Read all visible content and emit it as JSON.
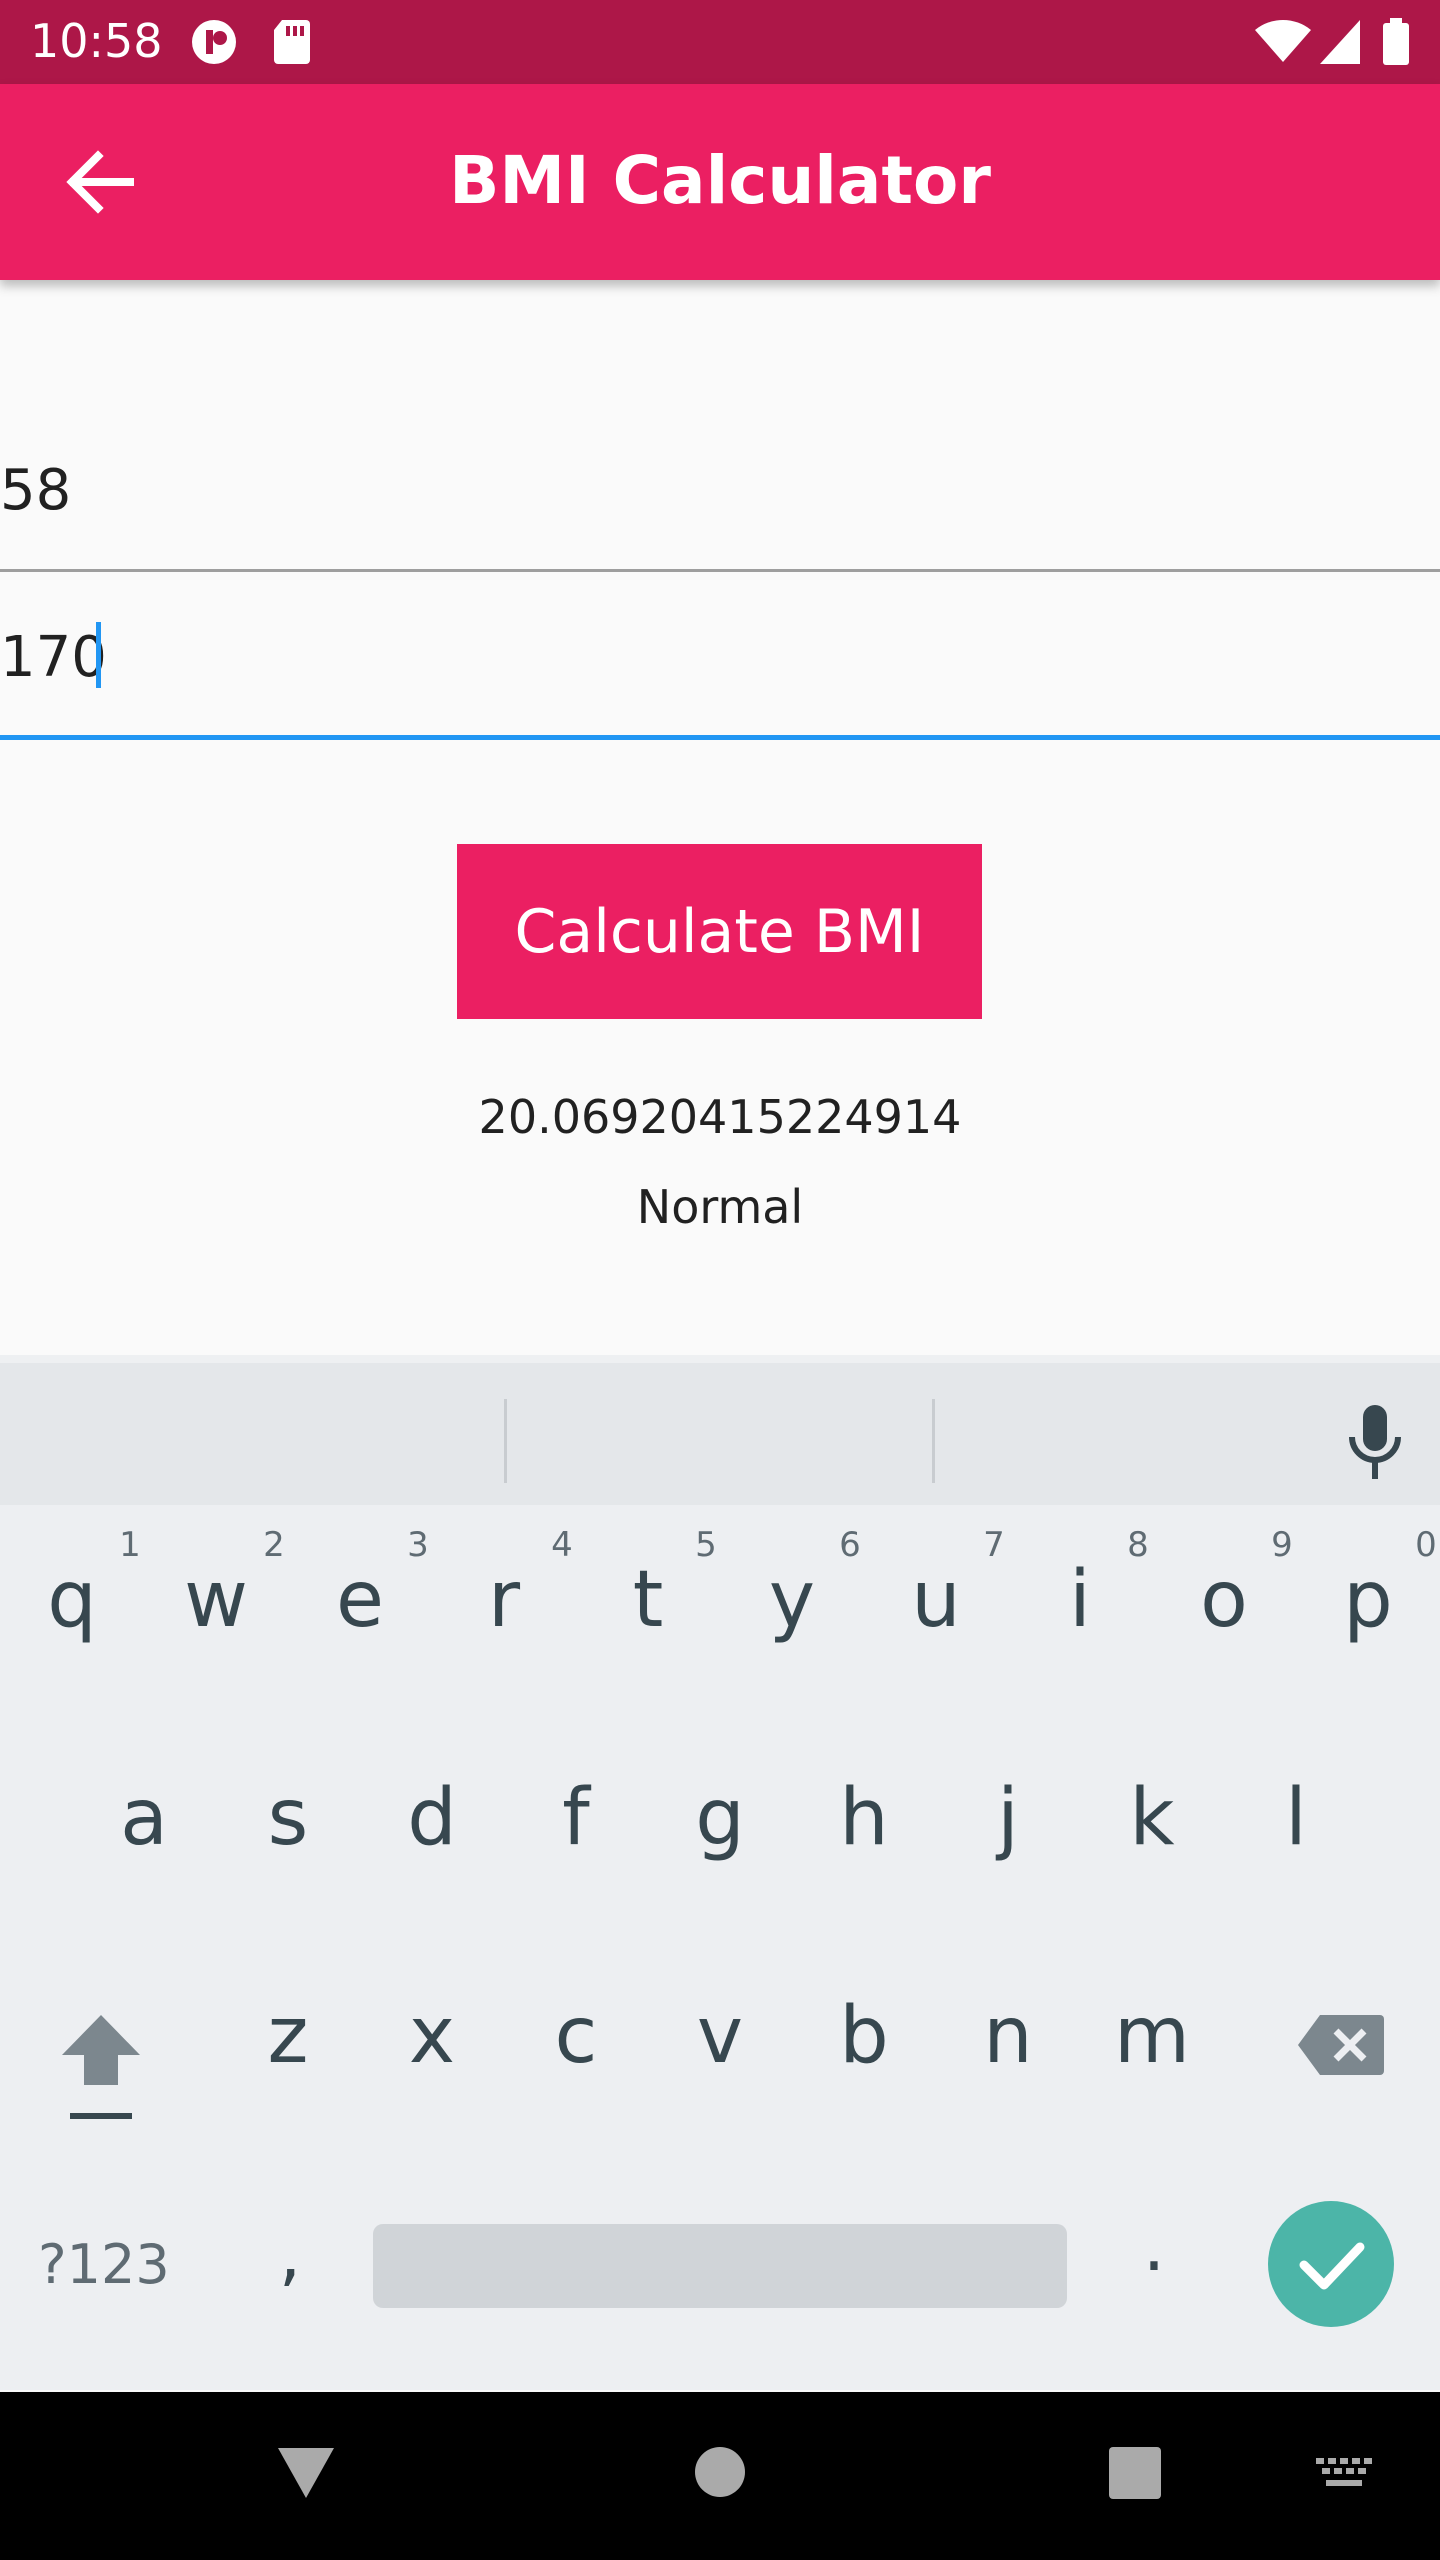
{
  "status_bar": {
    "time": "10:58"
  },
  "app_bar": {
    "title": "BMI Calculator"
  },
  "form": {
    "weight_value": "58",
    "height_value": "170",
    "calculate_label": "Calculate BMI"
  },
  "result": {
    "bmi_value": "20.06920415224914",
    "category": "Normal"
  },
  "keyboard": {
    "row1": [
      {
        "letter": "q",
        "num": "1"
      },
      {
        "letter": "w",
        "num": "2"
      },
      {
        "letter": "e",
        "num": "3"
      },
      {
        "letter": "r",
        "num": "4"
      },
      {
        "letter": "t",
        "num": "5"
      },
      {
        "letter": "y",
        "num": "6"
      },
      {
        "letter": "u",
        "num": "7"
      },
      {
        "letter": "i",
        "num": "8"
      },
      {
        "letter": "o",
        "num": "9"
      },
      {
        "letter": "p",
        "num": "0"
      }
    ],
    "row2": [
      "a",
      "s",
      "d",
      "f",
      "g",
      "h",
      "j",
      "k",
      "l"
    ],
    "row3": [
      "z",
      "x",
      "c",
      "v",
      "b",
      "n",
      "m"
    ],
    "symbols_label": "?123",
    "comma": ",",
    "period": "."
  },
  "colors": {
    "status_bar": "#ad1748",
    "app_bar": "#eb1f62",
    "accent": "#2196f3",
    "enter_key": "#4cb5a8"
  }
}
